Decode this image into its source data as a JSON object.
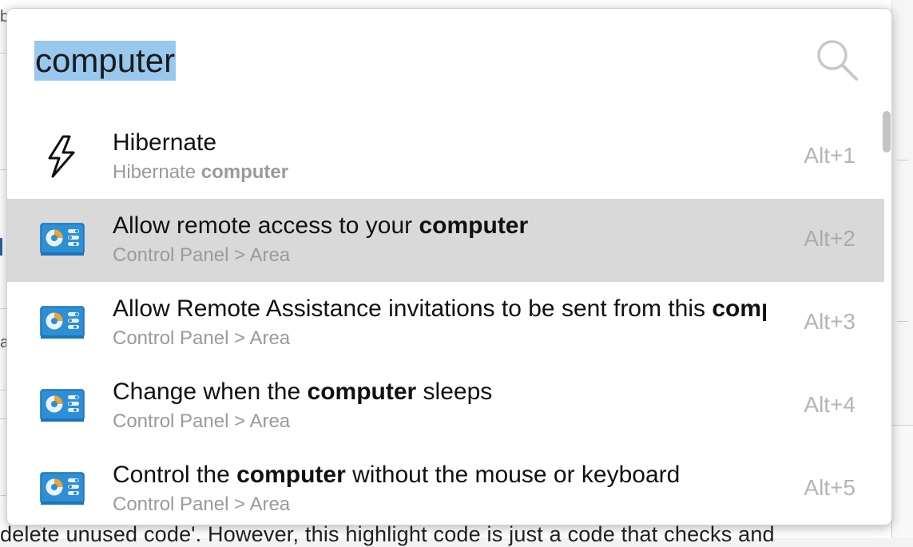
{
  "background": {
    "fragment_b": "b",
    "fragment_a": "a",
    "bottom_text": "delete unused code'. However, this highlight code is just a code that checks and"
  },
  "search": {
    "query": "computer",
    "icon": "search-icon"
  },
  "results": [
    {
      "title_parts": [
        {
          "text": "Hibernate",
          "bold": false
        }
      ],
      "subtitle_parts": [
        {
          "text": "Hibernate ",
          "bold": false
        },
        {
          "text": "computer",
          "bold": true
        }
      ],
      "shortcut": "Alt+1",
      "icon": "lightning-bolt-icon",
      "selected": false
    },
    {
      "title_parts": [
        {
          "text": "Allow remote access to your ",
          "bold": false
        },
        {
          "text": "computer",
          "bold": true
        }
      ],
      "subtitle_parts": [
        {
          "text": "Control Panel > Area",
          "bold": false
        }
      ],
      "shortcut": "Alt+2",
      "icon": "control-panel-icon",
      "selected": true
    },
    {
      "title_parts": [
        {
          "text": "Allow Remote Assistance invitations to be sent from this ",
          "bold": false
        },
        {
          "text": "computer",
          "bold": true
        }
      ],
      "subtitle_parts": [
        {
          "text": "Control Panel > Area",
          "bold": false
        }
      ],
      "shortcut": "Alt+3",
      "icon": "control-panel-icon",
      "selected": false
    },
    {
      "title_parts": [
        {
          "text": "Change when the ",
          "bold": false
        },
        {
          "text": "computer",
          "bold": true
        },
        {
          "text": " sleeps",
          "bold": false
        }
      ],
      "subtitle_parts": [
        {
          "text": "Control Panel > Area",
          "bold": false
        }
      ],
      "shortcut": "Alt+4",
      "icon": "control-panel-icon",
      "selected": false
    },
    {
      "title_parts": [
        {
          "text": "Control the ",
          "bold": false
        },
        {
          "text": "computer",
          "bold": true
        },
        {
          "text": " without the mouse or keyboard",
          "bold": false
        }
      ],
      "subtitle_parts": [
        {
          "text": "Control Panel > Area",
          "bold": false
        }
      ],
      "shortcut": "Alt+5",
      "icon": "control-panel-icon",
      "selected": false
    }
  ],
  "scrollbar": {
    "position_fraction": 0.0
  }
}
